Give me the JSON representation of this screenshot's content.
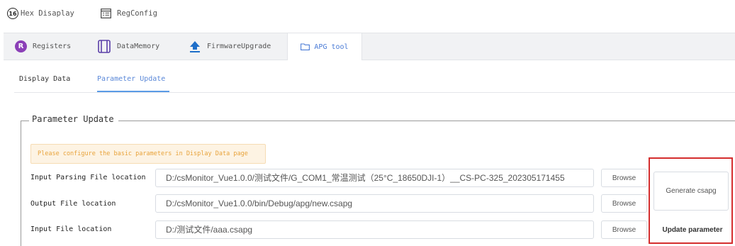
{
  "toolbar": {
    "hex_badge": "16",
    "hex_display_label": "Hex Disaplay",
    "regconfig_label": "RegConfig"
  },
  "main_tabs": [
    {
      "label": "Registers",
      "icon": "registers-r-icon",
      "active": false
    },
    {
      "label": "DataMemory",
      "icon": "data-memory-icon",
      "active": false
    },
    {
      "label": "FirmwareUpgrade",
      "icon": "upload-arrow-icon",
      "active": false
    },
    {
      "label": "APG tool",
      "icon": "folder-icon",
      "active": true
    }
  ],
  "registers_badge": "R",
  "sub_tabs": [
    {
      "label": "Display Data",
      "active": false
    },
    {
      "label": "Parameter Update",
      "active": true
    }
  ],
  "section": {
    "legend": "Parameter Update",
    "warning": "Please configure the basic parameters in Display Data page"
  },
  "rows": [
    {
      "label": "Input Parsing File location",
      "value": "D:/csMonitor_Vue1.0.0/测试文件/G_COM1_常温测试（25°C_18650DJI-1）__CS-PC-325_202305171455",
      "button": "Browse"
    },
    {
      "label": "Output File location",
      "value": "D:/csMonitor_Vue1.0.0/bin/Debug/apg/new.csapg",
      "button": "Browse"
    },
    {
      "label": "Input File location",
      "value": "D:/测试文件/aaa.csapg",
      "button": "Browse"
    }
  ],
  "actions": {
    "generate": "Generate csapg",
    "update": "Update parameter"
  },
  "colors": {
    "active_tab_text": "#4a7bd6",
    "warning_text": "#e8a33b",
    "highlight_frame": "#d42e2e",
    "registers_badge": "#8b3fb7"
  }
}
